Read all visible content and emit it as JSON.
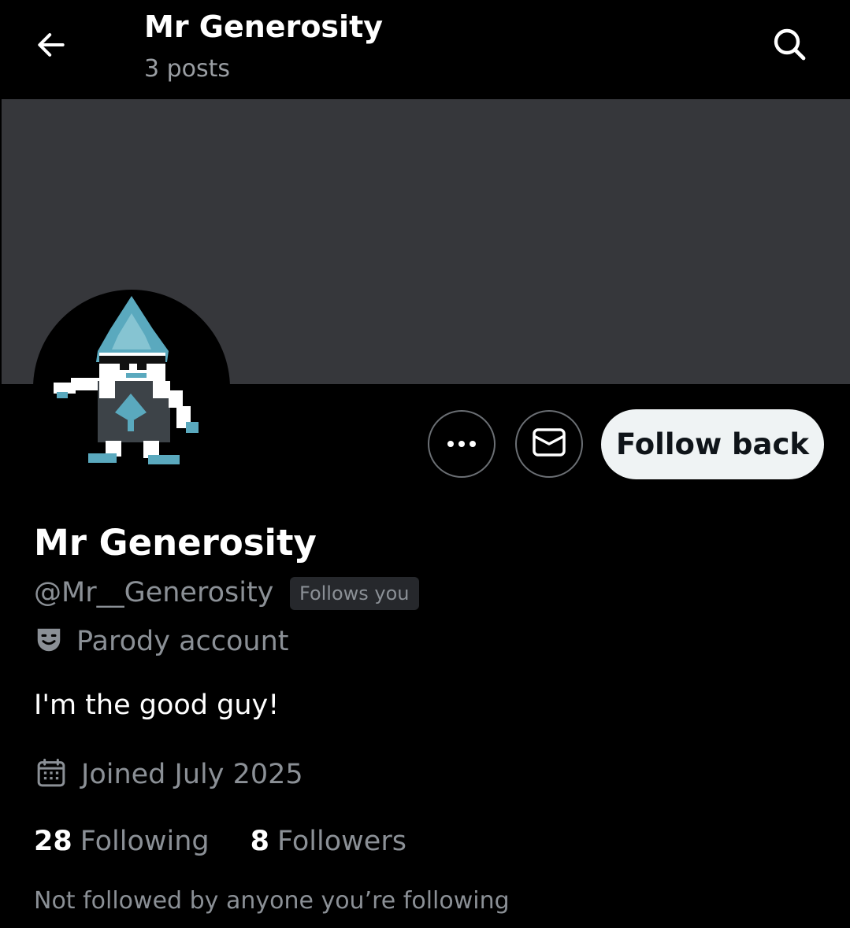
{
  "header": {
    "title": "Mr Generosity",
    "posts_count": "3 posts",
    "back_icon": "arrow-left-icon",
    "search_icon": "search-icon"
  },
  "colors": {
    "background": "#000000",
    "banner": "#36373b",
    "follow_button_bg": "#eff3f4",
    "secondary_text": "#8b9096",
    "avatar_accent": "#5aa9be"
  },
  "actions": {
    "more_icon": "more-horizontal-icon",
    "message_icon": "envelope-icon",
    "follow_label": "Follow back"
  },
  "profile": {
    "display_name": "Mr Generosity",
    "handle": "@Mr__Generosity",
    "follows_you_badge": "Follows you",
    "parody_label": "Parody account",
    "bio": "I'm the good guy!",
    "joined": "Joined July 2025",
    "following_count": "28",
    "following_label": "Following",
    "followers_count": "8",
    "followers_label": "Followers",
    "mutuals_text": "Not followed by anyone you’re following"
  }
}
